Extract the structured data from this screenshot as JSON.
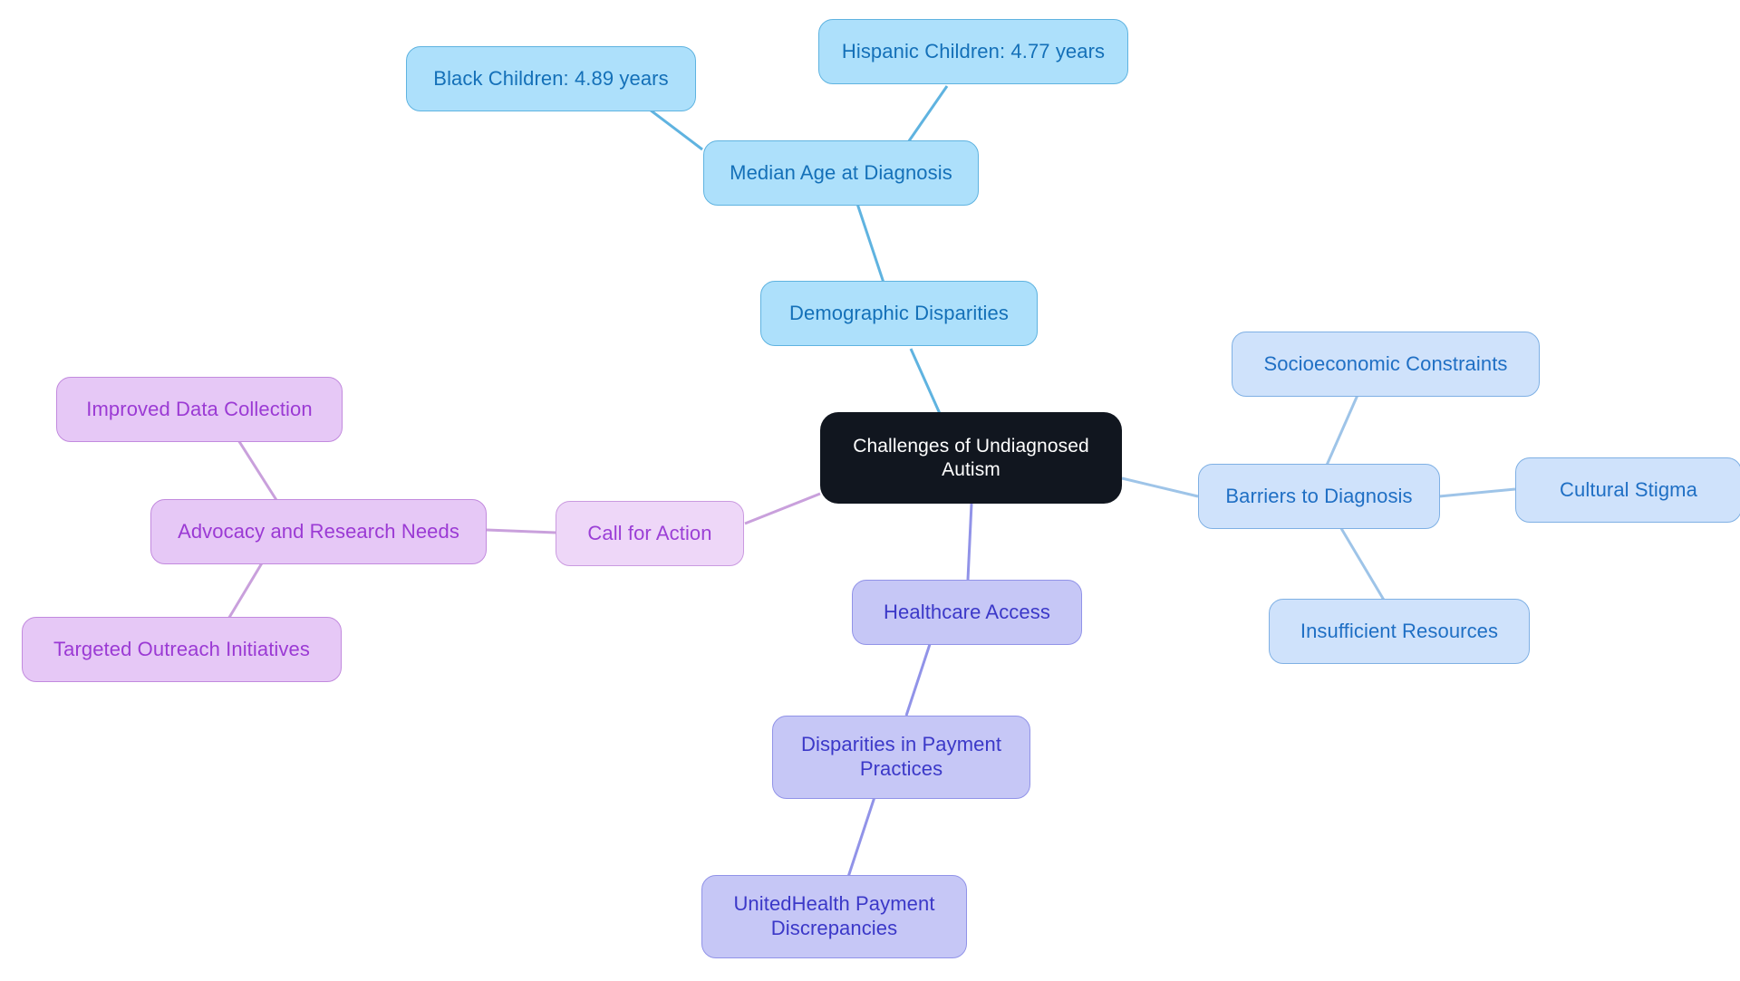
{
  "diagram": {
    "type": "mindmap",
    "title": "Challenges of Undiagnosed Autism",
    "background": "#ffffff",
    "palette": {
      "root_fill": "#11161f",
      "root_text": "#ffffff",
      "blue_dark_fill": "#ade0fb",
      "blue_dark_stroke": "#5fb3e0",
      "blue_dark_text": "#1470b8",
      "blue_light_fill": "#cfe2fb",
      "blue_light_stroke": "#7fb0e4",
      "blue_light_text": "#1f6fc4",
      "periwinkle_fill": "#c6c7f6",
      "periwinkle_stroke": "#9193e8",
      "periwinkle_text": "#3b38c8",
      "pink_light_fill": "#eed7f8",
      "pink_light_stroke": "#ca9ae0",
      "pink_light_text": "#9b3fd6",
      "pink_mid_fill": "#e6c8f6",
      "pink_mid_stroke": "#c28ade",
      "pink_mid_text": "#9b3ad4"
    },
    "root": {
      "label": "Challenges of Undiagnosed\nAutism"
    },
    "branches": [
      {
        "id": "demographic-disparities",
        "label": "Demographic Disparities",
        "color": "#5fb3e0",
        "children": [
          {
            "id": "median-age-at-diagnosis",
            "label": "Median Age at Diagnosis",
            "children": [
              {
                "id": "black-children",
                "label": "Black Children: 4.89 years"
              },
              {
                "id": "hispanic-children",
                "label": "Hispanic Children: 4.77 years"
              }
            ]
          }
        ]
      },
      {
        "id": "barriers-to-diagnosis",
        "label": "Barriers to Diagnosis",
        "color": "#9ec4e8",
        "children": [
          {
            "id": "socioeconomic-constraints",
            "label": "Socioeconomic Constraints"
          },
          {
            "id": "cultural-stigma",
            "label": "Cultural Stigma"
          },
          {
            "id": "insufficient-resources",
            "label": "Insufficient Resources"
          }
        ]
      },
      {
        "id": "healthcare-access",
        "label": "Healthcare Access",
        "color": "#9193e8",
        "children": [
          {
            "id": "disparities-in-payment-practices",
            "label": "Disparities in Payment\nPractices",
            "children": [
              {
                "id": "unitedhealth-payment-discrepancies",
                "label": "UnitedHealth Payment\nDiscrepancies"
              }
            ]
          }
        ]
      },
      {
        "id": "call-for-action",
        "label": "Call for Action",
        "color": "#c9a0dc",
        "children": [
          {
            "id": "advocacy-and-research-needs",
            "label": "Advocacy and Research Needs",
            "children": [
              {
                "id": "improved-data-collection",
                "label": "Improved Data Collection"
              },
              {
                "id": "targeted-outreach-initiatives",
                "label": "Targeted Outreach Initiatives"
              }
            ]
          }
        ]
      }
    ],
    "nodes": {
      "root": {
        "label": "Challenges of Undiagnosed\nAutism"
      },
      "demographic_disparities": {
        "label": "Demographic Disparities"
      },
      "median_age": {
        "label": "Median Age at Diagnosis"
      },
      "black_children": {
        "label": "Black Children: 4.89 years"
      },
      "hispanic_children": {
        "label": "Hispanic Children: 4.77 years"
      },
      "barriers": {
        "label": "Barriers to Diagnosis"
      },
      "socioeconomic": {
        "label": "Socioeconomic Constraints"
      },
      "cultural_stigma": {
        "label": "Cultural Stigma"
      },
      "insufficient_resources": {
        "label": "Insufficient Resources"
      },
      "healthcare_access": {
        "label": "Healthcare Access"
      },
      "payment_practices": {
        "label": "Disparities in Payment\nPractices"
      },
      "unitedhealth": {
        "label": "UnitedHealth Payment\nDiscrepancies"
      },
      "call_for_action": {
        "label": "Call for Action"
      },
      "advocacy": {
        "label": "Advocacy and Research Needs"
      },
      "improved_data": {
        "label": "Improved Data Collection"
      },
      "targeted_outreach": {
        "label": "Targeted Outreach Initiatives"
      }
    }
  }
}
